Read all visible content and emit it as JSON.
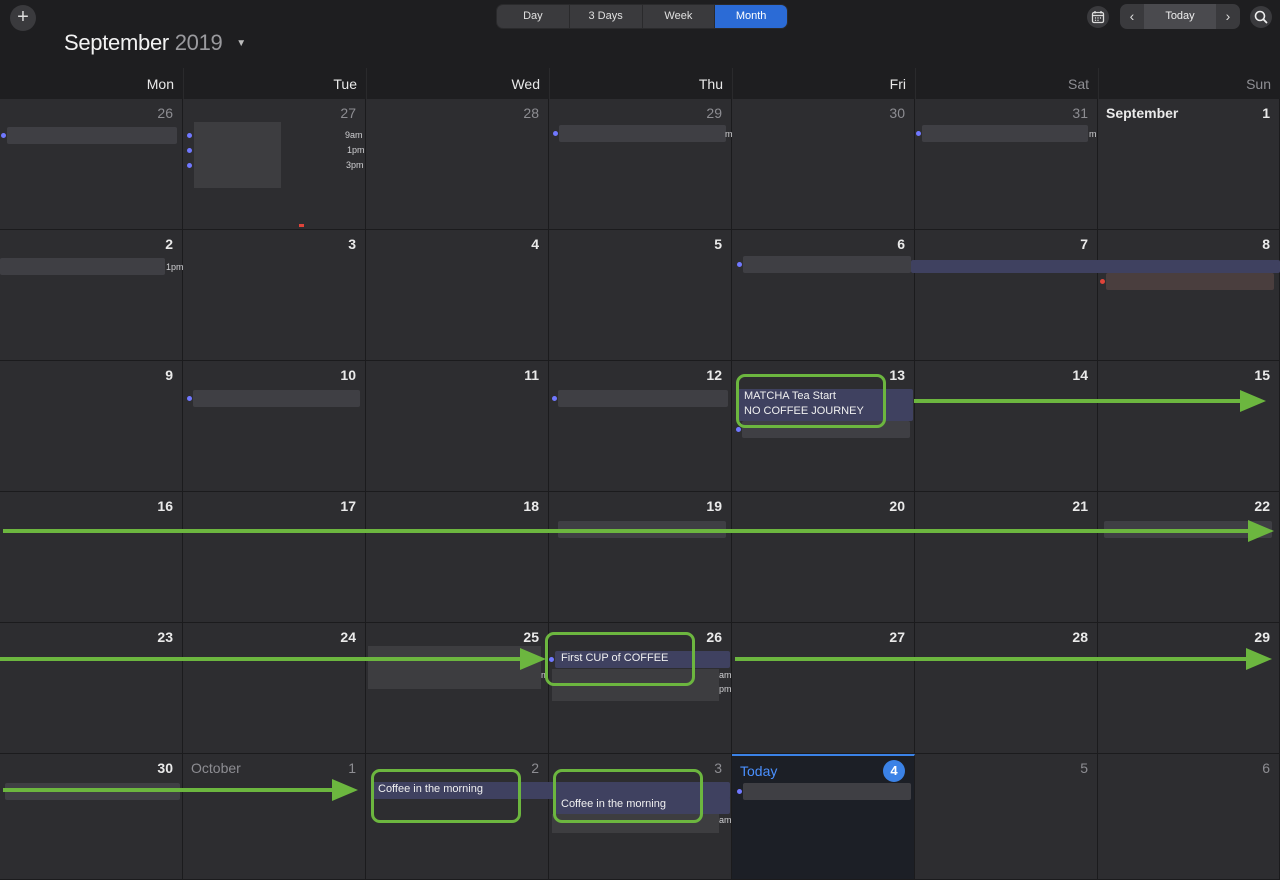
{
  "toolbar": {
    "add_label": "+",
    "month_title": "September",
    "year_title": "2019",
    "views": [
      "Day",
      "3 Days",
      "Week",
      "Month"
    ],
    "active_view": "Month",
    "today_label": "Today",
    "prev_label": "‹",
    "next_label": "›"
  },
  "weekdays": [
    "Mon",
    "Tue",
    "Wed",
    "Thu",
    "Fri",
    "Sat",
    "Sun"
  ],
  "weeks": [
    [
      "26",
      "27",
      "28",
      "29",
      "30",
      "31",
      "1"
    ],
    [
      "2",
      "3",
      "4",
      "5",
      "6",
      "7",
      "8"
    ],
    [
      "9",
      "10",
      "11",
      "12",
      "13",
      "14",
      "15"
    ],
    [
      "16",
      "17",
      "18",
      "19",
      "20",
      "21",
      "22"
    ],
    [
      "23",
      "24",
      "25",
      "26",
      "27",
      "28",
      "29"
    ],
    [
      "30",
      "1",
      "2",
      "3",
      "4",
      "5",
      "6"
    ]
  ],
  "month_labels": {
    "september": "September",
    "october": "October",
    "today": "Today"
  },
  "times": {
    "t9am": "9am",
    "t1pm": "1pm",
    "t3pm": "3pm",
    "t1pm_b": "1pm",
    "am": "am",
    "pm": "pm",
    "m": "m"
  },
  "events": {
    "matcha": "MATCHA Tea Start",
    "no_coffee": "NO COFFEE JOURNEY",
    "first_cup": "First CUP of COFFEE",
    "coffee_morning_1": "Coffee in the morning",
    "coffee_morning_2": "Coffee in the morning"
  },
  "colors": {
    "accent": "#2b6bd6",
    "annotation": "#6cb63f",
    "today": "#3b82e6"
  }
}
